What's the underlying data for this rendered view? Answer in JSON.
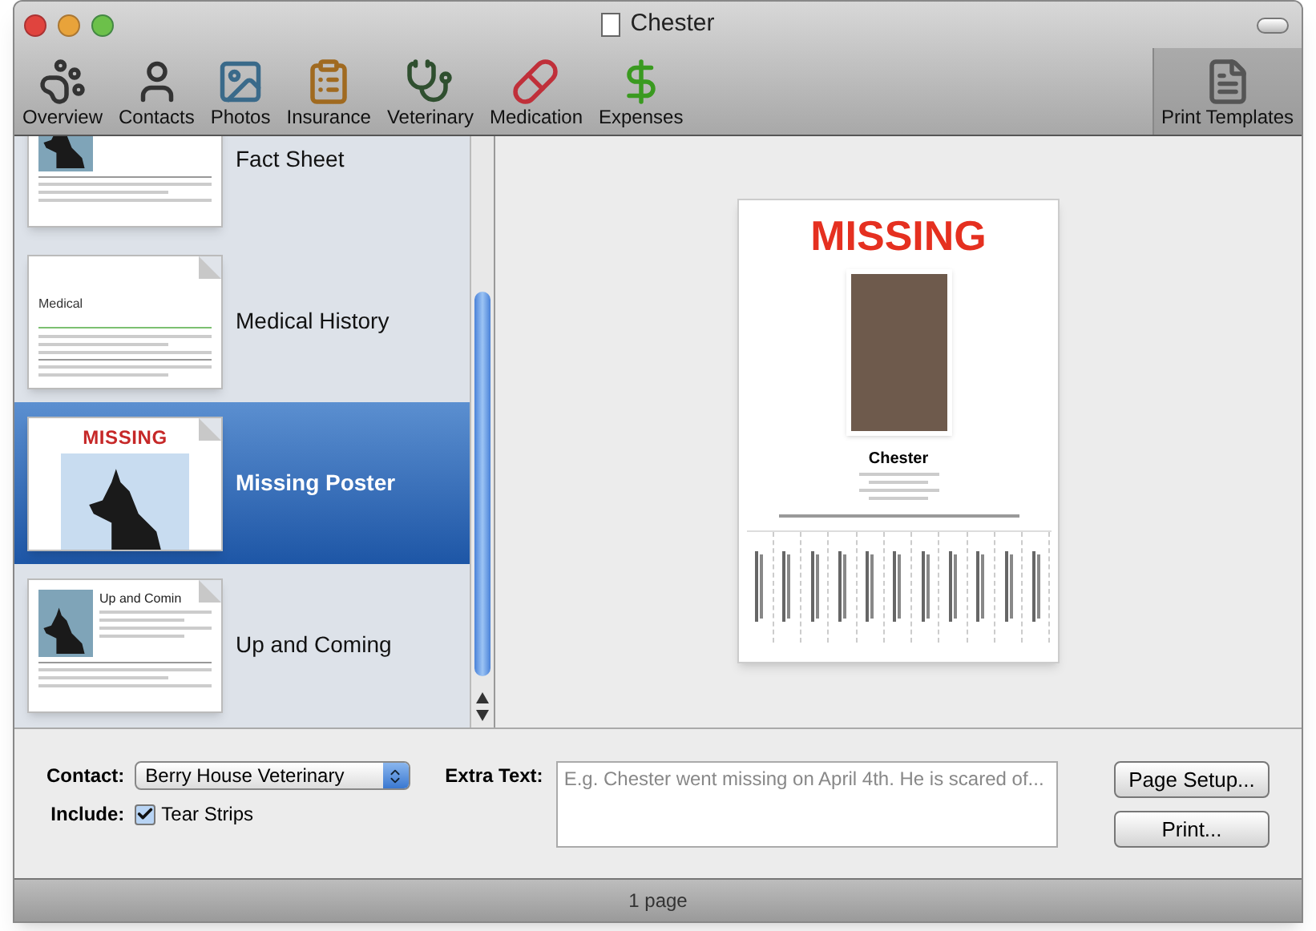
{
  "window": {
    "title": "Chester"
  },
  "toolbar": [
    {
      "kind": "paw",
      "label": "Overview",
      "selected": false
    },
    {
      "kind": "person",
      "label": "Contacts",
      "selected": false
    },
    {
      "kind": "photo",
      "label": "Photos",
      "selected": false
    },
    {
      "kind": "clipboard",
      "label": "Insurance",
      "selected": false
    },
    {
      "kind": "vet",
      "label": "Veterinary",
      "selected": false
    },
    {
      "kind": "pill",
      "label": "Medication",
      "selected": false
    },
    {
      "kind": "dollar",
      "label": "Expenses",
      "selected": false
    },
    {
      "kind": "templates",
      "label": "Print Templates",
      "selected": true
    }
  ],
  "templates": [
    {
      "kind": "profile",
      "name": "Fact Sheet",
      "selected": false
    },
    {
      "kind": "medical",
      "name": "Medical History",
      "thumb_title": "Medical",
      "selected": false
    },
    {
      "kind": "poster",
      "name": "Missing Poster",
      "thumb_title": "MISSING",
      "selected": true
    },
    {
      "kind": "profile",
      "name": "Up and Coming",
      "thumb_title": "Up and Comin",
      "selected": false
    }
  ],
  "preview": {
    "headline": "MISSING",
    "pet_name": "Chester"
  },
  "form": {
    "contact_label": "Contact:",
    "contact_value": "Berry House Veterinary",
    "include_label": "Include:",
    "tear_strips": {
      "label": "Tear Strips",
      "checked": true
    },
    "extra_text_label": "Extra Text:",
    "extra_text_placeholder": "E.g. Chester went missing on April 4th. He is scared of...",
    "buttons": [
      "Page Setup...",
      "Print..."
    ]
  },
  "status_bar": "1 page"
}
